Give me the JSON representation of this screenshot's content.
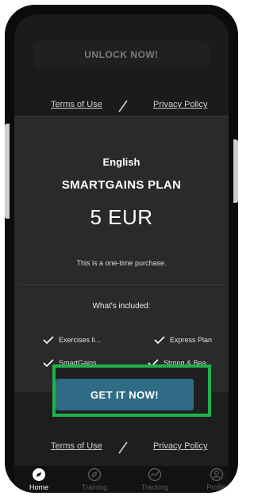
{
  "top": {
    "unlock_label": "UNLOCK NOW!"
  },
  "links": {
    "terms": "Terms of Use",
    "privacy": "Privacy Policy"
  },
  "plan": {
    "language": "English",
    "name": "SMARTGAINS PLAN",
    "price": "5 EUR",
    "note": "This is a one-time purchase.",
    "included_title": "What's included:",
    "features": [
      "Exercises li...",
      "Express Plan",
      "SmartGains",
      "Strong & Bea..."
    ]
  },
  "cta": {
    "label": "GET IT NOW!"
  },
  "nav": {
    "items": [
      {
        "label": "Home",
        "icon": "compass-icon",
        "active": true
      },
      {
        "label": "Training",
        "icon": "training-icon",
        "active": false
      },
      {
        "label": "Tracking",
        "icon": "tracking-icon",
        "active": false
      },
      {
        "label": "Profile",
        "icon": "profile-icon",
        "active": false
      }
    ]
  },
  "colors": {
    "cta": "#2f6b85",
    "highlight": "#1fb24b",
    "background": "#1e1e1e"
  }
}
